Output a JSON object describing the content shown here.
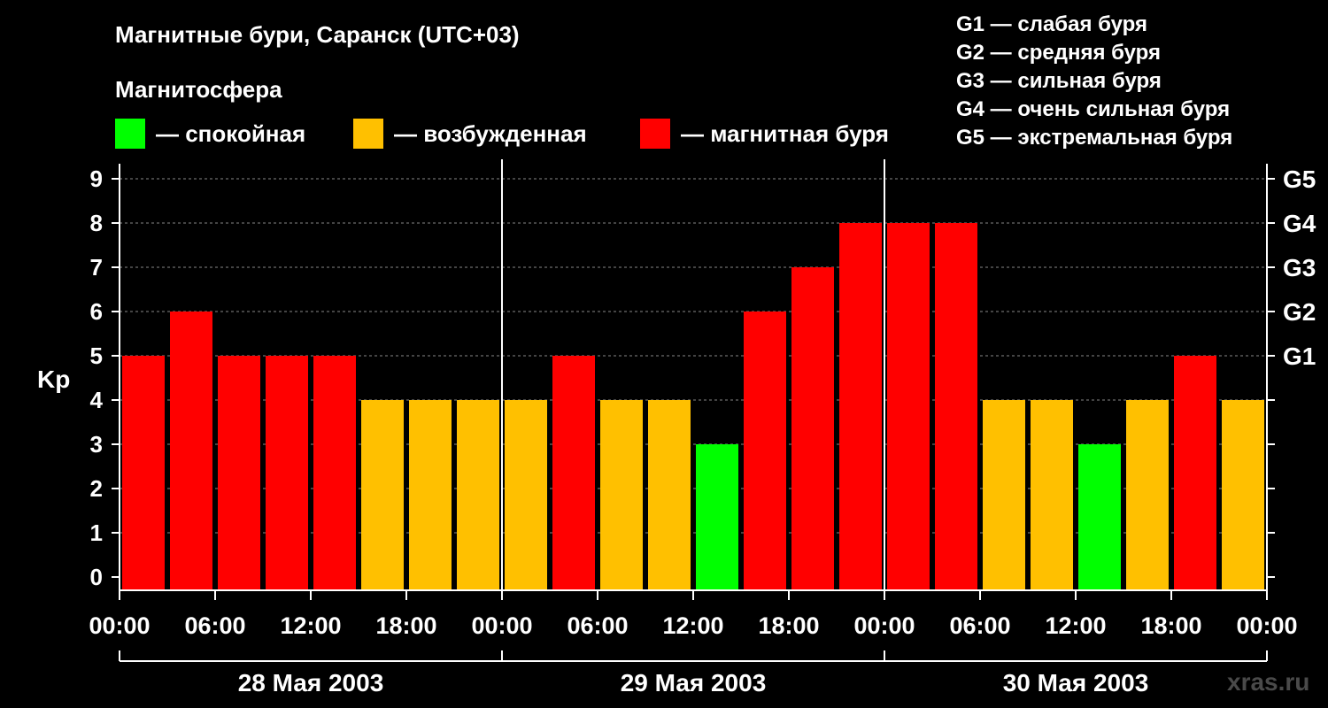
{
  "header": {
    "title": "Магнитные бури, Саранск (UTC+03)",
    "subtitle": "Магнитосфера"
  },
  "legend": [
    {
      "label": "— спокойная",
      "color": "#00ff00"
    },
    {
      "label": "— возбужденная",
      "color": "#ffc000"
    },
    {
      "label": "— магнитная буря",
      "color": "#ff0000"
    }
  ],
  "g_legend": [
    "G1 — слабая буря",
    "G2 — средняя буря",
    "G3 — сильная буря",
    "G4 — очень сильная буря",
    "G5 — экстремальная буря"
  ],
  "watermark": "xras.ru",
  "chart_data": {
    "type": "bar",
    "ylabel": "Kp",
    "ylim": [
      0,
      9
    ],
    "y_ticks": [
      "0",
      "1",
      "2",
      "3",
      "4",
      "5",
      "6",
      "7",
      "8",
      "9"
    ],
    "right_axis_labels": [
      {
        "kp": 5,
        "label": "G1"
      },
      {
        "kp": 6,
        "label": "G2"
      },
      {
        "kp": 7,
        "label": "G3"
      },
      {
        "kp": 8,
        "label": "G4"
      },
      {
        "kp": 9,
        "label": "G5"
      }
    ],
    "x_tick_labels": [
      "00:00",
      "06:00",
      "12:00",
      "18:00",
      "00:00",
      "06:00",
      "12:00",
      "18:00",
      "00:00",
      "06:00",
      "12:00",
      "18:00",
      "00:00"
    ],
    "day_labels": [
      "28 Мая 2003",
      "29 Мая 2003",
      "30 Мая 2003"
    ],
    "values": [
      5,
      6,
      5,
      5,
      5,
      4,
      4,
      4,
      4,
      5,
      4,
      4,
      3,
      6,
      7,
      8,
      8,
      8,
      4,
      4,
      3,
      4,
      5,
      4
    ],
    "colors": {
      "quiet": "#00ff00",
      "disturbed": "#ffc000",
      "storm": "#ff0000"
    },
    "grid": true
  }
}
